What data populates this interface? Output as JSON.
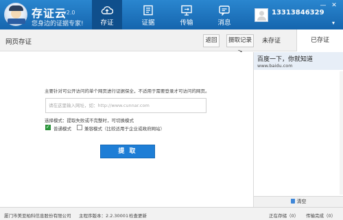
{
  "app": {
    "name": "存证云",
    "version": "v2.0",
    "slogan": "您身边的证据专家!",
    "user_phone": "13313846329",
    "window_controls": [
      "—",
      "✕"
    ],
    "user_menu": "▾"
  },
  "nav": [
    {
      "label": "存证",
      "icon": "cloud-upload-icon",
      "active": true
    },
    {
      "label": "证据",
      "icon": "document-list-icon",
      "active": false
    },
    {
      "label": "传输",
      "icon": "monitor-transfer-icon",
      "active": false
    },
    {
      "label": "消息",
      "icon": "message-icon",
      "active": false
    }
  ],
  "toolbar": {
    "title": "网页存证",
    "back_label": "返回",
    "history_label": "摄取记录 >",
    "tab_unsaved": "未存证",
    "tab_saved": "已存证"
  },
  "main": {
    "description": "主要针对可公开访问的单个网页进行证据保全，不适用于需要登录才可访问的网页。",
    "url_placeholder": "请在这里输入网址，如：http://www.cunnar.com",
    "mode_hint": "选择模式：提取失败或不完整时，可切换模式",
    "mode_normal": "普通模式",
    "mode_compat": "兼容模式（比较适用于企业或政府网站）",
    "extract_label": "提 取"
  },
  "history": {
    "item_title": "百度一下，你就知道",
    "item_url": "www.baidu.com",
    "clear_label": "清空"
  },
  "status": {
    "company": "厦门市美亚柏科信息股份有限公司",
    "version_label": "主程序版本：2.2.30001",
    "check_update": "检查更新",
    "storing": "正在存储（0）",
    "transferring": "传输完成（0）"
  },
  "colors": {
    "header_blue": "#1a72bf",
    "active_tab": "#0f4f8c",
    "button_blue": "#1e7ed6",
    "checkbox_green": "#2a9a3c"
  }
}
